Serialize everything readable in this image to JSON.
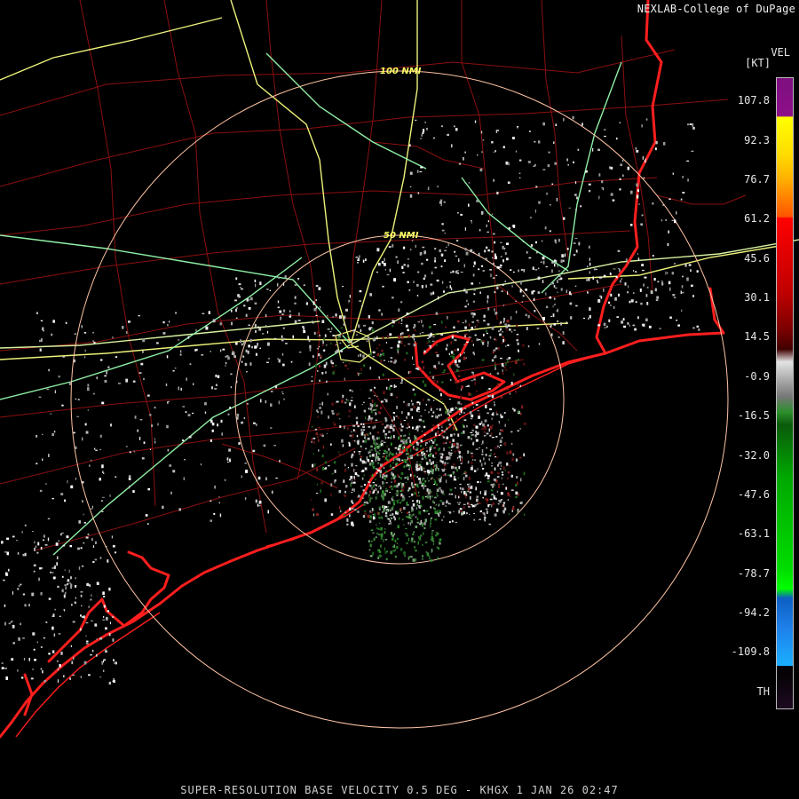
{
  "credit": "NEXLAB-College of DuPage",
  "legend": {
    "title": "VEL",
    "unit": "[KT]",
    "ticks": [
      "107.8",
      "92.3",
      "76.7",
      "61.2",
      "45.6",
      "30.1",
      "14.5",
      "-0.9",
      "-16.5",
      "-32.0",
      "-47.6",
      "-63.1",
      "-78.7",
      "-94.2",
      "-109.8",
      "TH"
    ]
  },
  "map": {
    "rings": [
      {
        "label": "100 NMI"
      },
      {
        "label": "50 NMI"
      }
    ]
  },
  "footer": "SUPER-RESOLUTION BASE VELOCITY 0.5 DEG - KHGX 1 JAN 26 02:47",
  "colors": {
    "background": "#000000",
    "county_lines": "#8b1010",
    "state_lines": "#ff2a2a",
    "highway_yellow": "#eef27a",
    "highway_green": "#8ff0a6",
    "ring": "#ffc4a4"
  }
}
